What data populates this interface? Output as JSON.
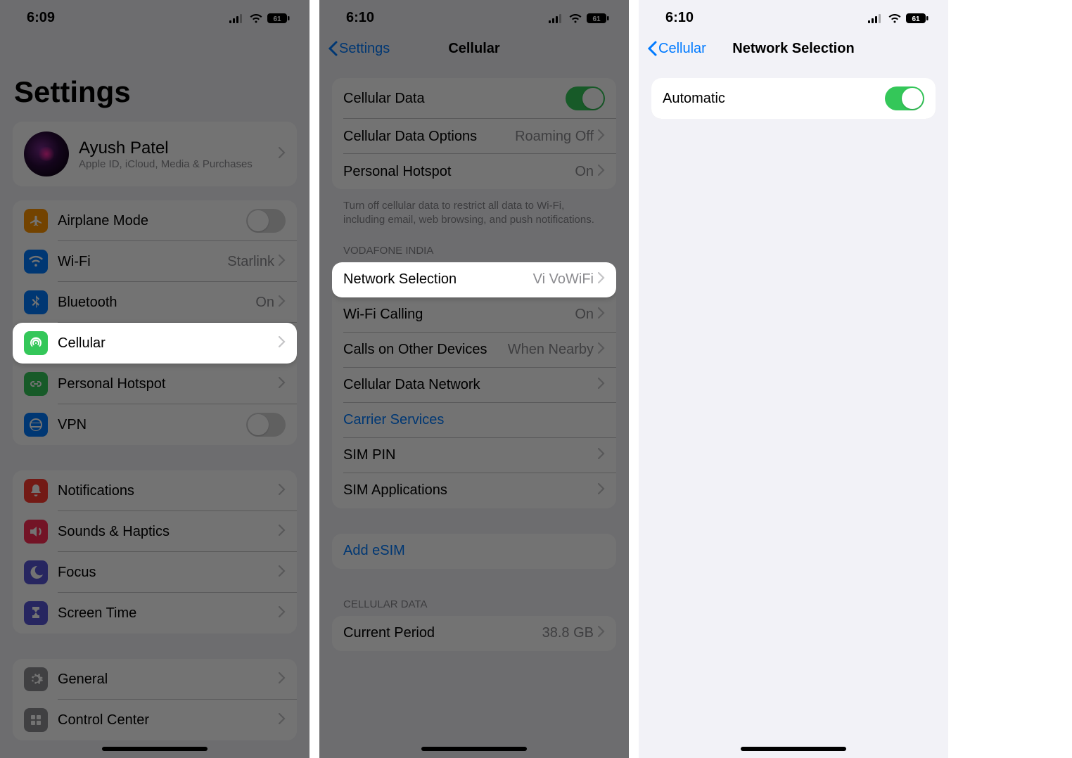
{
  "phones": [
    {
      "time": "6:09",
      "battery": "61",
      "title": "Settings",
      "profile": {
        "name": "Ayush Patel",
        "sub": "Apple ID, iCloud, Media & Purchases"
      },
      "rows1": [
        {
          "label": "Airplane Mode",
          "toggle": false,
          "iconColor": "#ff9500"
        },
        {
          "label": "Wi-Fi",
          "value": "Starlink",
          "iconColor": "#007aff"
        },
        {
          "label": "Bluetooth",
          "value": "On",
          "iconColor": "#007aff"
        },
        {
          "label": "Cellular",
          "iconColor": "#34c759",
          "highlight": true
        },
        {
          "label": "Personal Hotspot",
          "iconColor": "#34c759"
        },
        {
          "label": "VPN",
          "toggle": false,
          "iconColor": "#007aff"
        }
      ],
      "rows2": [
        {
          "label": "Notifications",
          "iconColor": "#ff3b30"
        },
        {
          "label": "Sounds & Haptics",
          "iconColor": "#ff2d55"
        },
        {
          "label": "Focus",
          "iconColor": "#5856d6"
        },
        {
          "label": "Screen Time",
          "iconColor": "#5856d6"
        }
      ],
      "rows3": [
        {
          "label": "General",
          "iconColor": "#8e8e93"
        },
        {
          "label": "Control Center",
          "iconColor": "#8e8e93"
        }
      ]
    },
    {
      "time": "6:10",
      "battery": "61",
      "back": "Settings",
      "title": "Cellular",
      "g1": [
        {
          "label": "Cellular Data",
          "toggle": true
        },
        {
          "label": "Cellular Data Options",
          "value": "Roaming Off"
        },
        {
          "label": "Personal Hotspot",
          "value": "On"
        }
      ],
      "g1foot": "Turn off cellular data to restrict all data to Wi-Fi, including email, web browsing, and push notifications.",
      "h2": "Vodafone India",
      "g2": [
        {
          "label": "Network Selection",
          "value": "Vi VoWiFi",
          "highlight": true
        },
        {
          "label": "Wi-Fi Calling",
          "value": "On"
        },
        {
          "label": "Calls on Other Devices",
          "value": "When Nearby"
        },
        {
          "label": "Cellular Data Network"
        },
        {
          "label": "Carrier Services",
          "link": true
        },
        {
          "label": "SIM PIN"
        },
        {
          "label": "SIM Applications"
        }
      ],
      "g3": [
        {
          "label": "Add eSIM",
          "link": true
        }
      ],
      "h4": "Cellular Data",
      "g4": [
        {
          "label": "Current Period",
          "value": "38.8 GB"
        }
      ]
    },
    {
      "time": "6:10",
      "battery": "61",
      "back": "Cellular",
      "title": "Network Selection",
      "rows": [
        {
          "label": "Automatic",
          "toggle": true,
          "highlight": true
        }
      ]
    }
  ]
}
